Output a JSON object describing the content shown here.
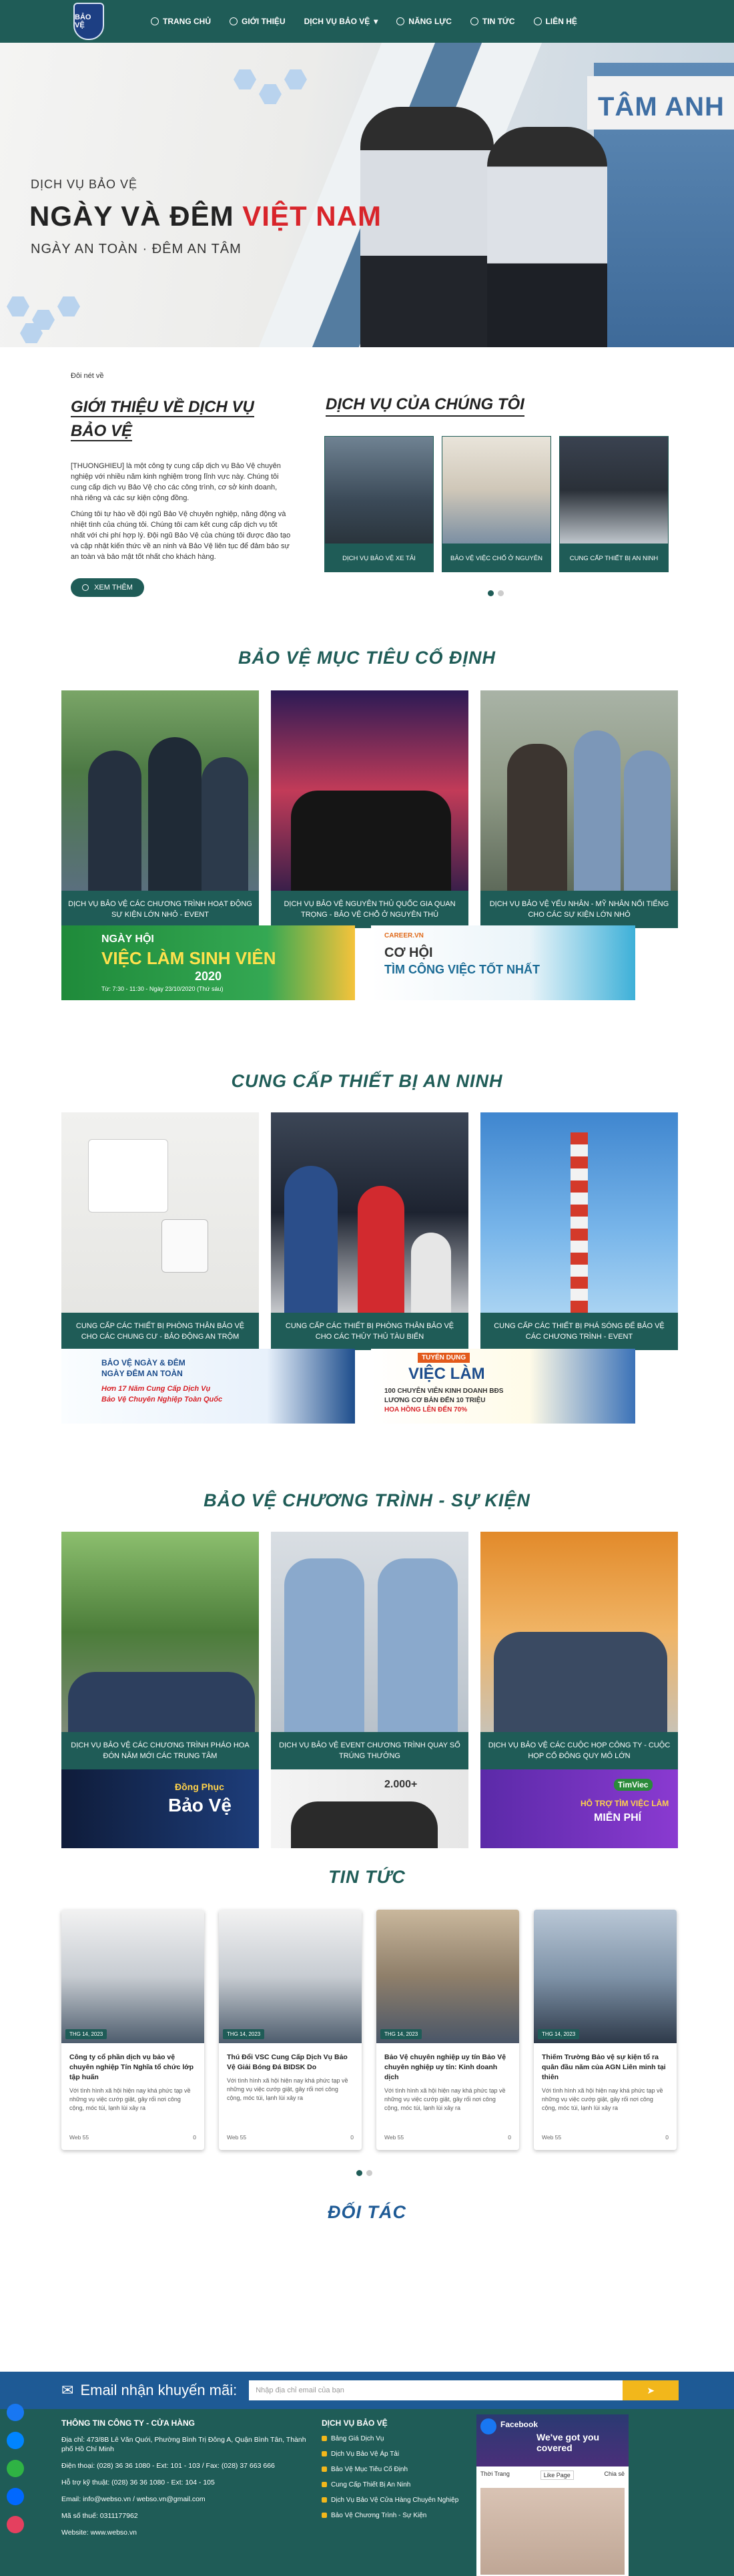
{
  "nav": {
    "logo_text": "BẢO VỆ",
    "items": [
      {
        "label": "TRANG CHỦ",
        "icon": "clock-icon"
      },
      {
        "label": "GIỚI THIỆU",
        "icon": "info-icon"
      },
      {
        "label": "DỊCH VỤ BẢO VỆ",
        "icon": "chevron-down-icon"
      },
      {
        "label": "NĂNG LỰC",
        "icon": "badge-icon"
      },
      {
        "label": "TIN TỨC",
        "icon": "document-icon"
      },
      {
        "label": "LIÊN HỆ",
        "icon": "phone-icon"
      }
    ]
  },
  "hero": {
    "line1": "DỊCH VỤ BẢO VỆ",
    "title_part1": "NGÀY VÀ ĐÊM ",
    "title_highlight": "VIỆT NAM",
    "tagline": "NGÀY AN TOÀN · ĐÊM AN TÂM",
    "building_sign": "TÂM ANH",
    "accent": "#d8242a"
  },
  "intro": {
    "crumb": "Đôi nét về",
    "title": "GIỚI THIỆU VỀ DỊCH VỤ BẢO VỆ",
    "para1": "[THUONGHIEU] là một công ty cung cấp dịch vụ Bảo Vệ chuyên nghiệp với nhiều năm kinh nghiệm trong lĩnh vực này. Chúng tôi cung cấp dịch vụ Bảo Vệ cho các công trình, cơ sở kinh doanh, nhà riêng và các sự kiện cộng đồng.",
    "para2": "Chúng tôi tự hào về đội ngũ Bảo Vệ chuyên nghiệp, năng động và nhiệt tình của chúng tôi. Chúng tôi cam kết cung cấp dịch vụ tốt nhất với chi phí hợp lý. Đội ngũ Bảo Vệ của chúng tôi được đào tạo và cập nhật kiến thức về an ninh và Bảo Vệ liên tục để đảm bảo sự an toàn và bảo mật tốt nhất cho khách hàng.",
    "button": "XEM THÊM"
  },
  "services": {
    "title": "DỊCH VỤ CỦA CHÚNG TÔI",
    "cards": [
      {
        "caption": "DỊCH VỤ BẢO VỆ XE TẢI"
      },
      {
        "caption": "BẢO VỆ VIỆC CHỐ Ở NGUYÊN"
      },
      {
        "caption": "CUNG CẤP THIẾT BỊ AN NINH"
      }
    ]
  },
  "section_fixed": {
    "title": "BẢO VỆ MỤC TIÊU CỐ ĐỊNH",
    "cards": [
      {
        "caption": "DỊCH VỤ BẢO VỆ CÁC CHƯƠNG TRÌNH HOẠT ĐỘNG SỰ KIỆN LỚN NHỎ - EVENT"
      },
      {
        "caption": "DỊCH VỤ BẢO VỆ NGUYÊN THỦ QUỐC GIA QUAN TRỌNG - BẢO VỆ CHỖ Ở NGUYÊN THỦ"
      },
      {
        "caption": "DỊCH VỤ BẢO VỆ YẾU NHÂN - MỸ NHÂN NỔI TIẾNG CHO CÁC SỰ KIỆN LỚN NHỎ"
      }
    ],
    "banner_left": {
      "top": "NGÀY HỘI",
      "main": "VIỆC LÀM SINH VIÊN",
      "year": "2020",
      "time": "Từ: 7:30 - 11:30 - Ngày 23/10/2020 (Thứ sáu)"
    },
    "banner_right": {
      "line1": "CƠ HỘI",
      "line2": "TÌM CÔNG VIỆC TỐT NHẤT",
      "hl": "TỐT NHẤT",
      "brand": "CAREER.VN"
    }
  },
  "section_equipment": {
    "title": "CUNG CẤP THIẾT BỊ AN NINH",
    "cards": [
      {
        "caption": "CUNG CẤP CÁC THIẾT BỊ PHÒNG THÂN BẢO VỆ CHO CÁC CHUNG CƯ - BẢO ĐỘNG AN TRỘM"
      },
      {
        "caption": "CUNG CẤP CÁC THIẾT BỊ PHÒNG THÂN BẢO VỆ CHO CÁC THỦY THỦ TÀU BIỂN"
      },
      {
        "caption": "CUNG CẤP CÁC THIẾT BỊ PHÁ SÓNG ĐỂ BẢO VỆ CÁC CHƯƠNG TRÌNH - EVENT"
      }
    ],
    "banner_left": {
      "line1": "BẢO VỆ NGÀY & ĐÊM",
      "line2": "NGÀY ĐÊM AN TOÀN",
      "line3": "Hơn 17 Năm Cung Cấp Dịch Vụ",
      "line4": "Bảo Vệ Chuyên Nghiệp Toàn Quốc"
    },
    "banner_right": {
      "tag": "TUYỂN DỤNG",
      "main": "VIỆC LÀM",
      "line1": "100 CHUYÊN VIÊN KINH DOANH BĐS",
      "line2": "LƯƠNG CƠ BẢN ĐẾN 10 TRIỆU",
      "line3": "HOA HỒNG LÊN ĐẾN 70%"
    }
  },
  "section_events": {
    "title": "BẢO VỆ CHƯƠNG TRÌNH - SỰ KIỆN",
    "cards": [
      {
        "caption": "DỊCH VỤ BẢO VỆ CÁC CHƯƠNG TRÌNH PHÁO HOA ĐÓN NĂM MỚI CÁC TRUNG TÂM"
      },
      {
        "caption": "DỊCH VỤ BẢO VỆ EVENT CHƯƠNG TRÌNH QUAY SỐ TRÚNG THƯỞNG"
      },
      {
        "caption": "DỊCH VỤ BẢO VỆ CÁC CUỘC HỌP CÔNG TY - CUỘC HỌP CỔ ĐÔNG QUY MÔ LỚN"
      }
    ],
    "banners": [
      {
        "line1": "Đồng Phục",
        "line2": "Bảo Vệ"
      },
      {
        "line1": "2.000+",
        "line2": ""
      },
      {
        "line1": "TimViec",
        "line2": "HỖ TRỢ TÌM VIỆC LÀM",
        "line3": "MIỄN PHÍ"
      }
    ]
  },
  "news": {
    "title": "TIN TỨC",
    "items": [
      {
        "date": "THG 14, 2023",
        "title": "Công ty cổ phần dịch vụ bảo vệ chuyên nghiệp Tín Nghĩa tổ chức lớp tập huấn",
        "excerpt": "Với tình hình xã hội hiện nay khá phức tạp về những vụ việc cướp giật, gây rối nơi công cộng, móc túi, lạnh lùi xảy ra",
        "author": "Web 55",
        "comments": "0"
      },
      {
        "date": "THG 14, 2023",
        "title": "Thú Đổi VSC Cung Cấp Dịch Vụ Bảo Vệ Giải Bóng Đá BIDSK Do",
        "excerpt": "Với tình hình xã hội hiện nay khá phức tạp về những vụ việc cướp giật, gây rối nơi công cộng, móc túi, lạnh lùi xảy ra",
        "author": "Web 55",
        "comments": "0"
      },
      {
        "date": "THG 14, 2023",
        "title": "Bảo Vệ chuyên nghiệp uy tín Bảo Vệ chuyên nghiệp uy tín: Kinh doanh dịch",
        "excerpt": "Với tình hình xã hội hiện nay khá phức tạp về những vụ việc cướp giật, gây rối nơi công cộng, móc túi, lạnh lùi xảy ra",
        "author": "Web 55",
        "comments": "0"
      },
      {
        "date": "THG 14, 2023",
        "title": "Thiếm Trường Bảo vệ sự kiện tổ ra quân đầu năm của AGN Liên minh tại thiên",
        "excerpt": "Với tình hình xã hội hiện nay khá phức tạp về những vụ việc cướp giật, gây rối nơi công cộng, móc túi, lạnh lùi xảy ra",
        "author": "Web 55",
        "comments": "0"
      }
    ]
  },
  "partners": {
    "title": "ĐỐI TÁC"
  },
  "newsletter": {
    "label": "Email nhận khuyến mãi:",
    "placeholder": "Nhập địa chỉ email của bạn",
    "button_icon": "send-icon"
  },
  "footer": {
    "info_title": "THÔNG TIN CÔNG TY - CỬA HÀNG",
    "address": "Địa chỉ: 473/8B Lê Văn Quới, Phường Bình Trị Đông A, Quận Bình Tân, Thành phố Hồ Chí Minh",
    "phone": "Điện thoại: (028) 36 36 1080 - Ext: 101 - 103  /  Fax: (028) 37 663 666",
    "hotline": "Hỗ trợ kỹ thuật: (028) 36 36 1080 - Ext: 104 - 105",
    "email": "Email: info@webso.vn / webso.vn@gmail.com",
    "tax": "Mã số thuế: 0311177962",
    "website": "Website: www.webso.vn",
    "links_title": "DỊCH VỤ BẢO VỆ",
    "links": [
      "Bảng Giá Dịch Vụ",
      "Dịch Vụ Bảo Vệ Áp Tải",
      "Bảo Vệ Mục Tiêu Cố Định",
      "Cung Cấp Thiết Bị An Ninh",
      "Dịch Vụ Bảo Vệ Cửa Hàng Chuyên Nghiệp",
      "Bảo Vệ Chương Trình - Sự Kiện"
    ],
    "fb_page": "Facebook",
    "fb_cover_text": "We've got you covered",
    "fb_button": "Like Page",
    "fb_tabs": [
      "Thời Trang",
      "Chia sẻ"
    ]
  }
}
